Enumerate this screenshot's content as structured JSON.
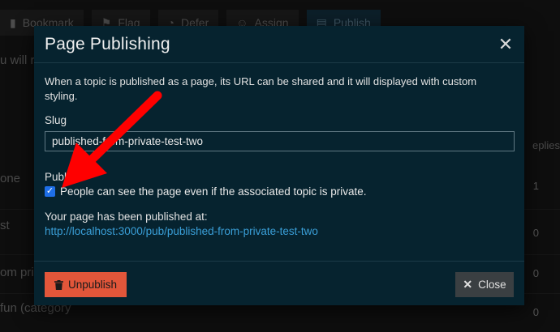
{
  "background": {
    "toolbar": [
      {
        "label": "Bookmark",
        "icon": "bookmark-icon"
      },
      {
        "label": "Flag",
        "icon": "flag-icon"
      },
      {
        "label": "Defer",
        "icon": "clock-icon"
      },
      {
        "label": "Assign",
        "icon": "user-plus-icon"
      },
      {
        "label": "Publish",
        "icon": "file-icon"
      }
    ],
    "line_fragment": "u will r",
    "col_header": "eplies",
    "rows": [
      {
        "text": "one",
        "count": "1"
      },
      {
        "text": "st",
        "count": "0"
      },
      {
        "text": "om pri",
        "count": "0"
      },
      {
        "text": "fun (category",
        "count": "0"
      }
    ]
  },
  "modal": {
    "title": "Page Publishing",
    "description": "When a topic is published as a page, its URL can be shared and it will displayed with custom styling.",
    "slug_label": "Slug",
    "slug_value": "published-from-private-test-two",
    "public_label": "Public",
    "public_checked": true,
    "public_text": "People can see the page even if the associated topic is private.",
    "published_at_label": "Your page has been published at:",
    "published_url": "http://localhost:3000/pub/published-from-private-test-two",
    "unpublish_label": "Unpublish",
    "close_label": "Close"
  },
  "colors": {
    "modal_bg": "#06232f",
    "unpublish": "#e2563a",
    "link": "#3a9fd8",
    "checkbox": "#1e6fe8",
    "annotation": "#ff0000"
  }
}
